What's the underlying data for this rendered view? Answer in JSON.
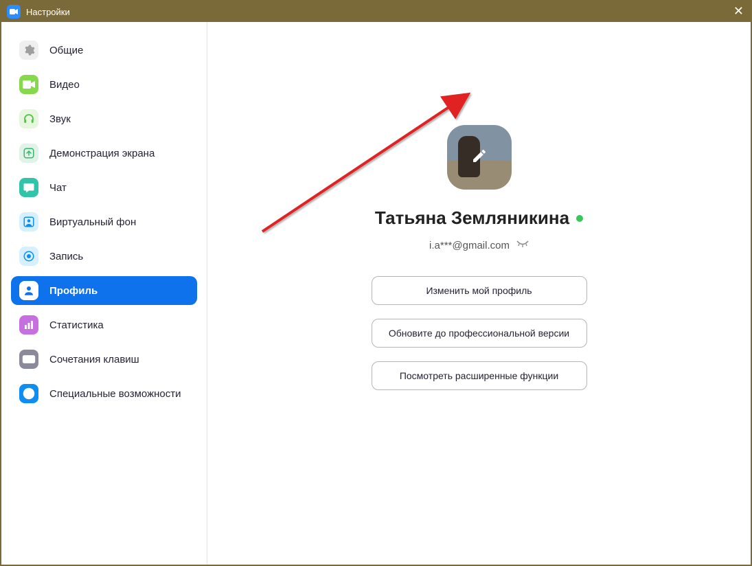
{
  "titlebar": {
    "title": "Настройки"
  },
  "sidebar": {
    "items": [
      {
        "id": "general",
        "label": "Общие",
        "icon": "gear",
        "bg": "#efefef",
        "fg": "#9f9f9f"
      },
      {
        "id": "video",
        "label": "Видео",
        "icon": "video",
        "bg": "#86d94a",
        "fg": "#ffffff"
      },
      {
        "id": "audio",
        "label": "Звук",
        "icon": "headphones",
        "bg": "#e7f6de",
        "fg": "#57c24b"
      },
      {
        "id": "share",
        "label": "Демонстрация экрана",
        "icon": "share",
        "bg": "#dff3e6",
        "fg": "#3cb46e"
      },
      {
        "id": "chat",
        "label": "Чат",
        "icon": "chat",
        "bg": "#32c4a8",
        "fg": "#ffffff"
      },
      {
        "id": "virtualbg",
        "label": "Виртуальный фон",
        "icon": "user-frame",
        "bg": "#d7f0ff",
        "fg": "#0d8ef0"
      },
      {
        "id": "recording",
        "label": "Запись",
        "icon": "record",
        "bg": "#d7f0ff",
        "fg": "#0d8ef0"
      },
      {
        "id": "profile",
        "label": "Профиль",
        "icon": "person",
        "bg": "#ffffff",
        "fg": "#0e72ed",
        "active": true
      },
      {
        "id": "stats",
        "label": "Статистика",
        "icon": "bars",
        "bg": "#c56fe0",
        "fg": "#ffffff"
      },
      {
        "id": "shortcuts",
        "label": "Сочетания клавиш",
        "icon": "keyboard",
        "bg": "#8a8a9a",
        "fg": "#ffffff"
      },
      {
        "id": "accessibility",
        "label": "Специальные возможности",
        "icon": "accessibility",
        "bg": "#0d8ef0",
        "fg": "#ffffff"
      }
    ]
  },
  "profile": {
    "name": "Татьяна Земляникина",
    "email": "i.a***@gmail.com",
    "buttons": {
      "edit": "Изменить мой профиль",
      "upgrade": "Обновите до профессиональной версии",
      "advanced": "Посмотреть расширенные функции"
    }
  }
}
